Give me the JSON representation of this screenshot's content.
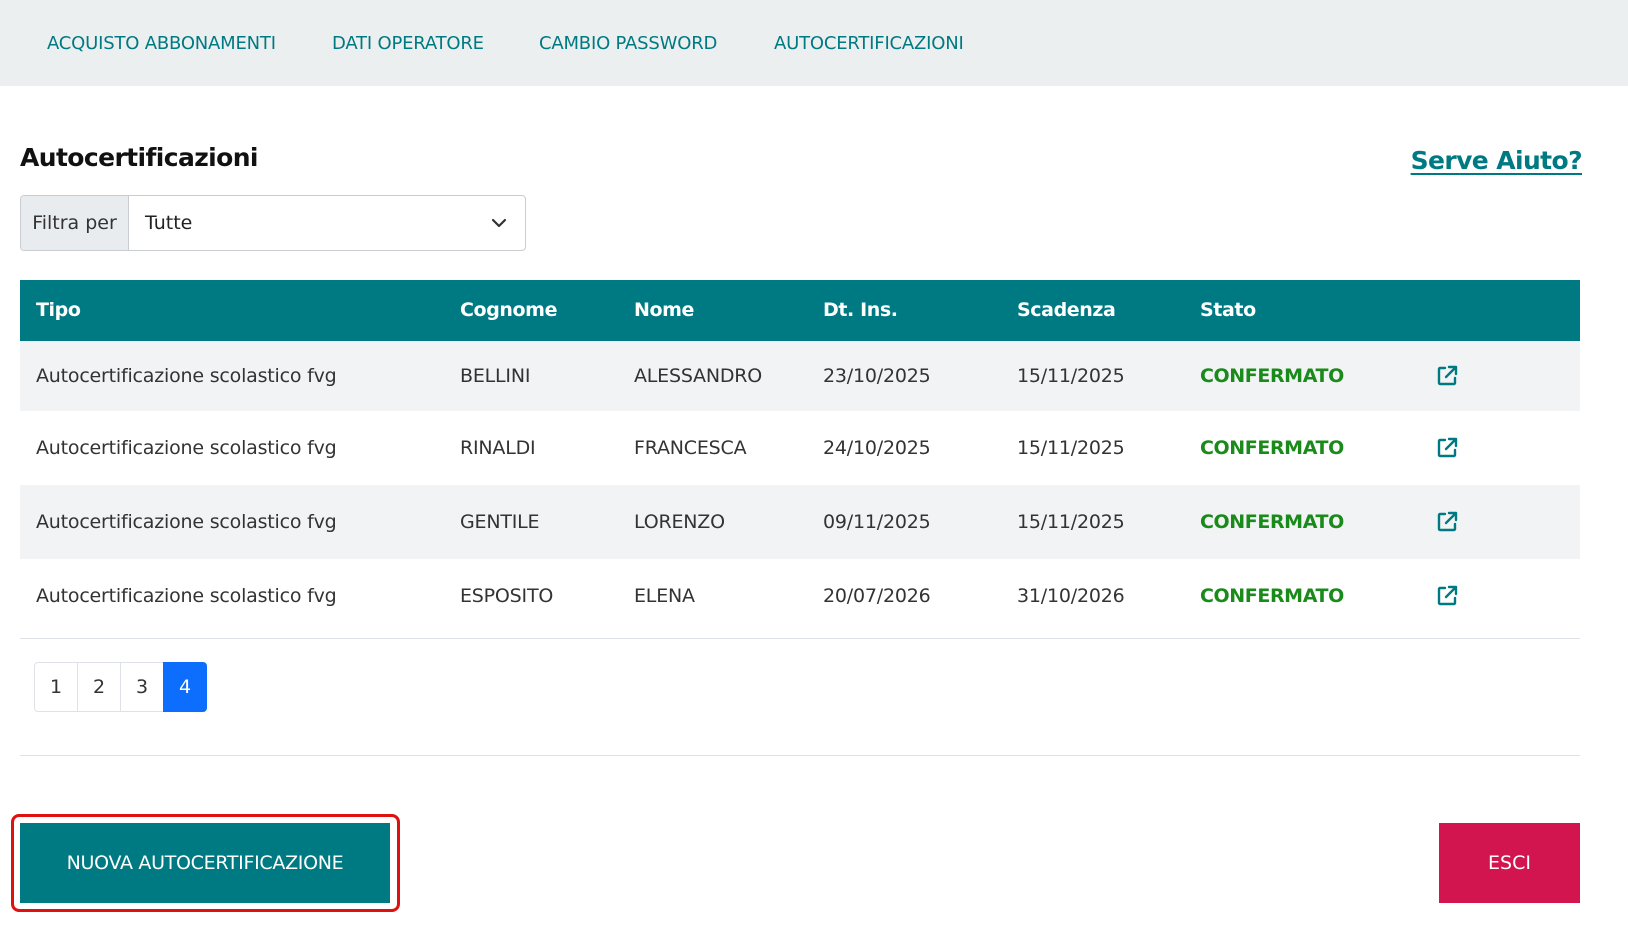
{
  "nav": {
    "items": [
      {
        "label": "ACQUISTO ABBONAMENTI"
      },
      {
        "label": "DATI OPERATORE"
      },
      {
        "label": "CAMBIO PASSWORD"
      },
      {
        "label": "AUTOCERTIFICAZIONI"
      }
    ]
  },
  "page": {
    "title": "Autocertificazioni",
    "help_link": "Serve Aiuto?"
  },
  "filter": {
    "label": "Filtra per",
    "selected": "Tutte"
  },
  "table": {
    "headers": [
      "Tipo",
      "Cognome",
      "Nome",
      "Dt. Ins.",
      "Scadenza",
      "Stato"
    ],
    "rows": [
      {
        "tipo": "Autocertificazione scolastico fvg",
        "cognome": "BELLINI",
        "nome": "ALESSANDRO",
        "dt_ins": "23/10/2025",
        "scadenza": "15/11/2025",
        "stato": "CONFERMATO"
      },
      {
        "tipo": "Autocertificazione scolastico fvg",
        "cognome": "RINALDI",
        "nome": "FRANCESCA",
        "dt_ins": "24/10/2025",
        "scadenza": "15/11/2025",
        "stato": "CONFERMATO"
      },
      {
        "tipo": "Autocertificazione scolastico fvg",
        "cognome": "GENTILE",
        "nome": "LORENZO",
        "dt_ins": "09/11/2025",
        "scadenza": "15/11/2025",
        "stato": "CONFERMATO"
      },
      {
        "tipo": "Autocertificazione scolastico fvg",
        "cognome": "ESPOSITO",
        "nome": "ELENA",
        "dt_ins": "20/07/2026",
        "scadenza": "31/10/2026",
        "stato": "CONFERMATO"
      }
    ],
    "row_action_icon": "external-link-icon"
  },
  "pagination": {
    "pages": [
      "1",
      "2",
      "3",
      "4"
    ],
    "active": "4"
  },
  "actions": {
    "new_label": "NUOVA AUTOCERTIFICAZIONE",
    "exit_label": "ESCI"
  },
  "colors": {
    "primary": "#007a82",
    "status_confirmed": "#1a8a1a",
    "exit": "#d3154f",
    "page_active": "#0d6efd",
    "highlight": "#e01010"
  }
}
